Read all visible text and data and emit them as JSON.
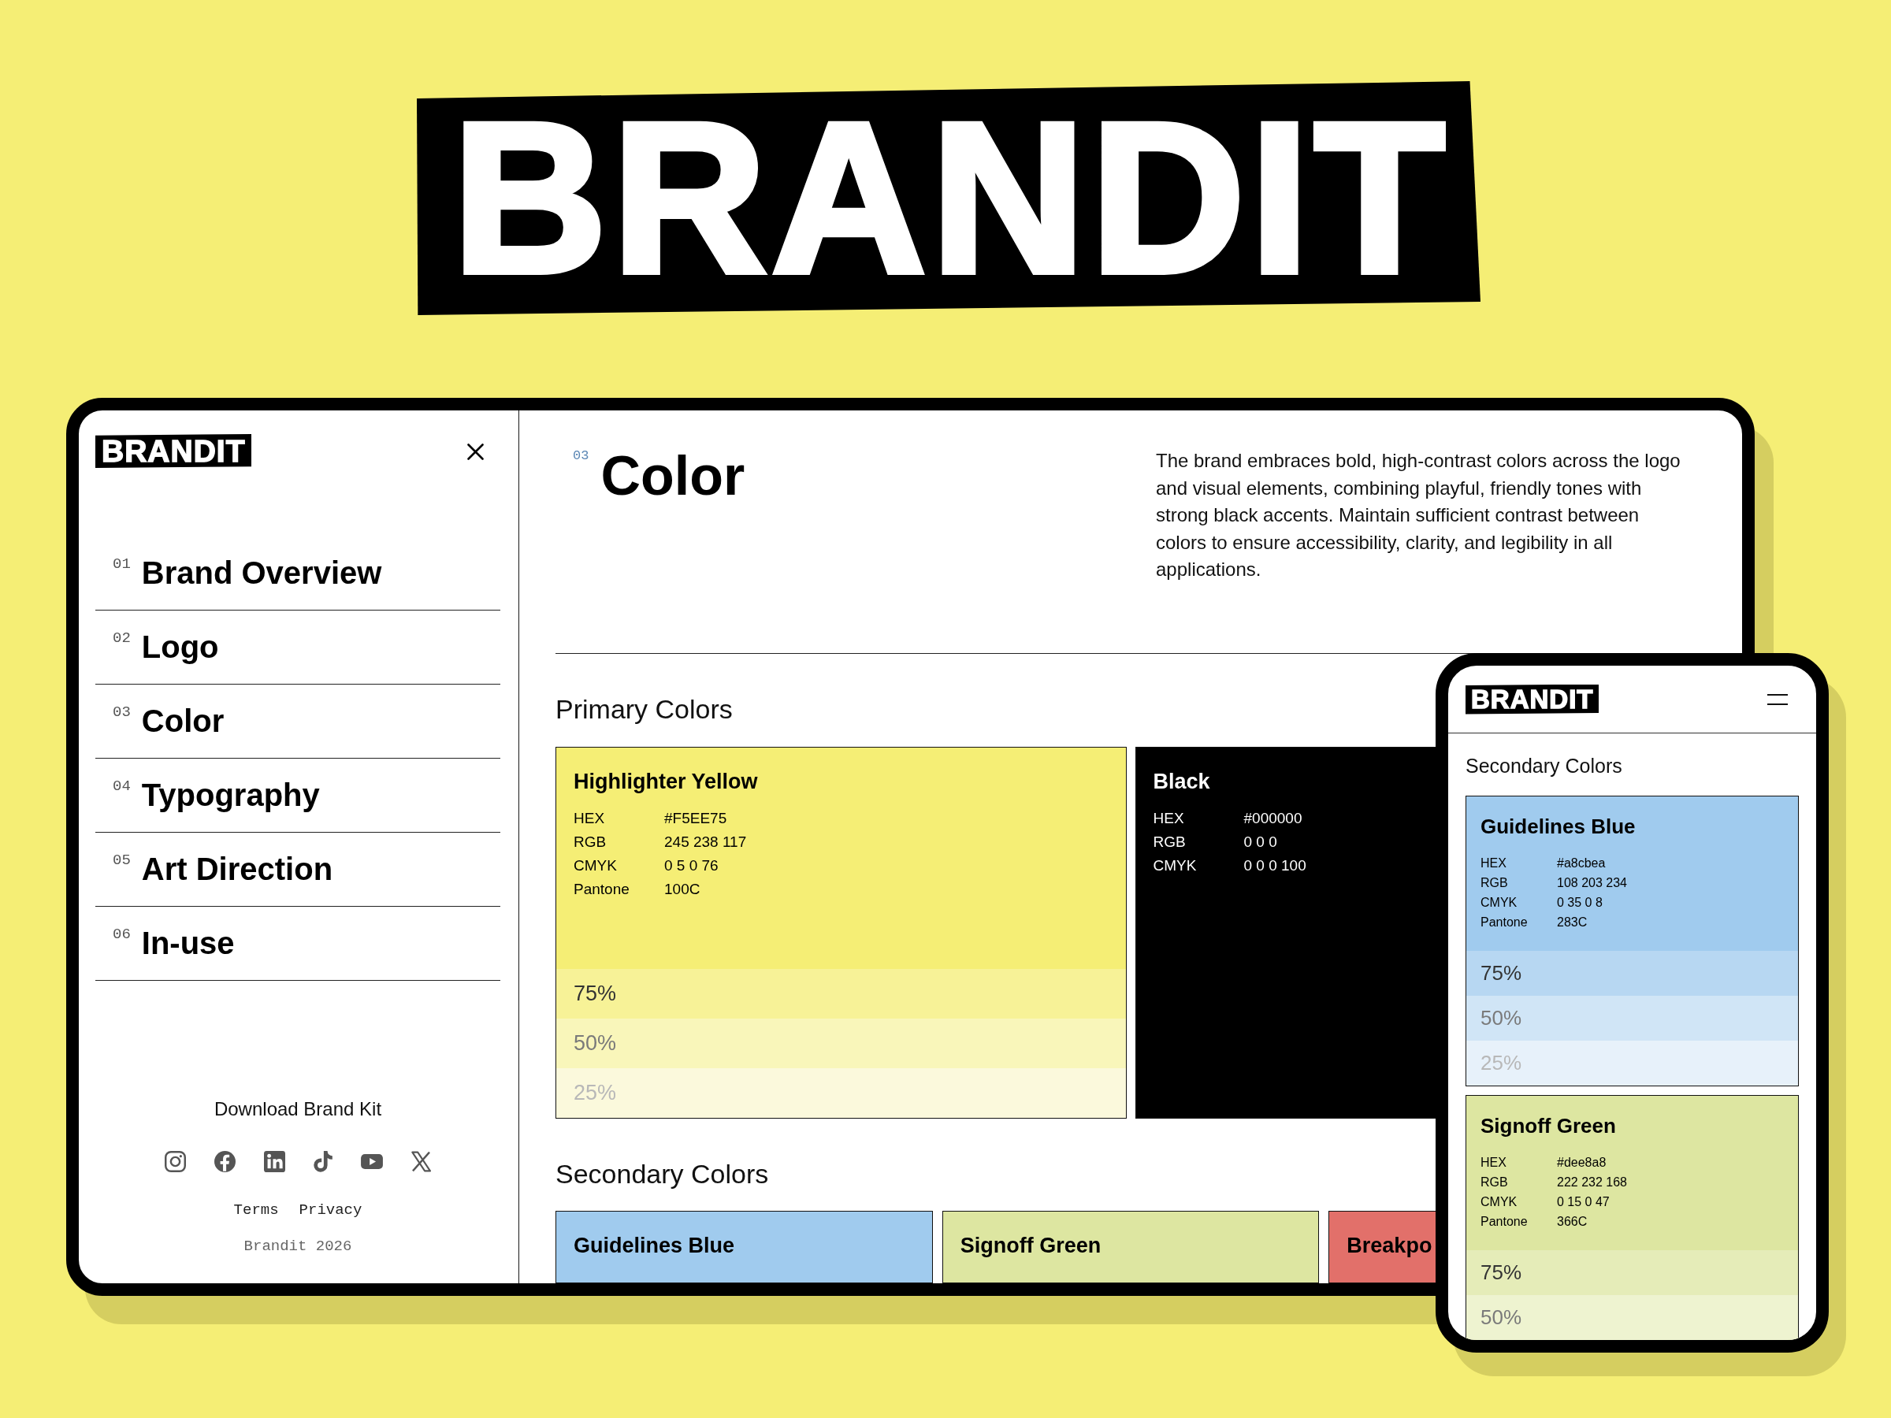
{
  "hero_logo": "BRANDIT",
  "laptop": {
    "sidebar": {
      "logo": "BRANDIT",
      "nav": [
        {
          "number": "01",
          "label": "Brand Overview"
        },
        {
          "number": "02",
          "label": "Logo"
        },
        {
          "number": "03",
          "label": "Color"
        },
        {
          "number": "04",
          "label": "Typography"
        },
        {
          "number": "05",
          "label": "Art Direction"
        },
        {
          "number": "06",
          "label": "In-use"
        }
      ],
      "download": "Download Brand Kit",
      "links": [
        "Terms",
        "Privacy"
      ],
      "copyright": "Brandit 2026"
    },
    "page": {
      "number": "03",
      "title": "Color",
      "description": "The brand embraces bold, high-contrast colors across the logo and visual elements, combining playful, friendly tones with strong black accents. Maintain sufficient contrast between colors to ensure accessibility, clarity, and legibility in all applications.",
      "sections": [
        {
          "heading": "Primary Colors",
          "cards": [
            {
              "name": "Highlighter Yellow",
              "color": "#f5ee75",
              "specs": [
                {
                  "label": "HEX",
                  "value": "#F5EE75"
                },
                {
                  "label": "RGB",
                  "value": "245 238 117"
                },
                {
                  "label": "CMYK",
                  "value": "0 5 0 76"
                },
                {
                  "label": "Pantone",
                  "value": "100C"
                }
              ],
              "tints": [
                {
                  "label": "75%",
                  "color": "#f7f297"
                },
                {
                  "label": "50%",
                  "color": "#f9f6ba"
                },
                {
                  "label": "25%",
                  "color": "#fbf9dc"
                }
              ]
            },
            {
              "name": "Black",
              "color": "#000000",
              "specs": [
                {
                  "label": "HEX",
                  "value": "#000000"
                },
                {
                  "label": "RGB",
                  "value": "0 0 0"
                },
                {
                  "label": "CMYK",
                  "value": "0 0 0 100"
                }
              ]
            }
          ]
        },
        {
          "heading": "Secondary Colors",
          "cards": [
            {
              "name": "Guidelines Blue",
              "color": "#a0cbee"
            },
            {
              "name": "Signoff Green",
              "color": "#dde6a1"
            },
            {
              "name": "Breakpo",
              "color": "#e2706a"
            }
          ]
        }
      ]
    }
  },
  "phone": {
    "logo": "BRANDIT",
    "heading": "Secondary Colors",
    "cards": [
      {
        "name": "Guidelines Blue",
        "color": "#a0cbee",
        "specs": [
          {
            "label": "HEX",
            "value": "#a8cbea"
          },
          {
            "label": "RGB",
            "value": "108 203 234"
          },
          {
            "label": "CMYK",
            "value": "0 35 0 8"
          },
          {
            "label": "Pantone",
            "value": "283C"
          }
        ],
        "tints": [
          {
            "label": "75%",
            "color": "#b7d7f2"
          },
          {
            "label": "50%",
            "color": "#d0e5f6"
          },
          {
            "label": "25%",
            "color": "#e7f1fa"
          }
        ]
      },
      {
        "name": "Signoff Green",
        "color": "#dde6a1",
        "specs": [
          {
            "label": "HEX",
            "value": "#dee8a8"
          },
          {
            "label": "RGB",
            "value": "222 232 168"
          },
          {
            "label": "CMYK",
            "value": "0 15 0 47"
          },
          {
            "label": "Pantone",
            "value": "366C"
          }
        ],
        "tints": [
          {
            "label": "75%",
            "color": "#e5ecb8"
          },
          {
            "label": "50%",
            "color": "#eef3d0"
          }
        ]
      }
    ]
  }
}
